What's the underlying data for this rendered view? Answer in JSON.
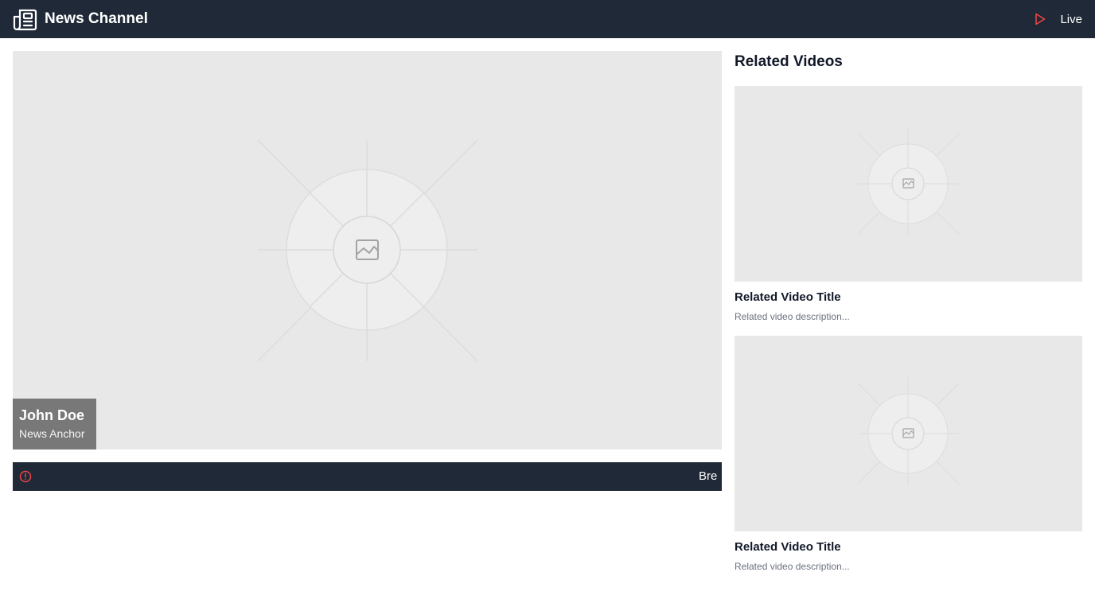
{
  "header": {
    "title": "News Channel",
    "logo_icon": "newspaper-icon",
    "live_label": "Live",
    "live_icon": "play-icon",
    "live_color": "#ef4444",
    "background": "#1f2937"
  },
  "player": {
    "thumbnail_icon": "image-placeholder-icon",
    "anchor_name": "John Doe",
    "anchor_role": "News Anchor"
  },
  "ticker": {
    "icon": "alert-circle-icon",
    "icon_color": "#ef4444",
    "text": "Bre"
  },
  "sidebar": {
    "title": "Related Videos",
    "videos": [
      {
        "title": "Related Video Title",
        "description": "Related video description..."
      },
      {
        "title": "Related Video Title",
        "description": "Related video description..."
      }
    ]
  }
}
